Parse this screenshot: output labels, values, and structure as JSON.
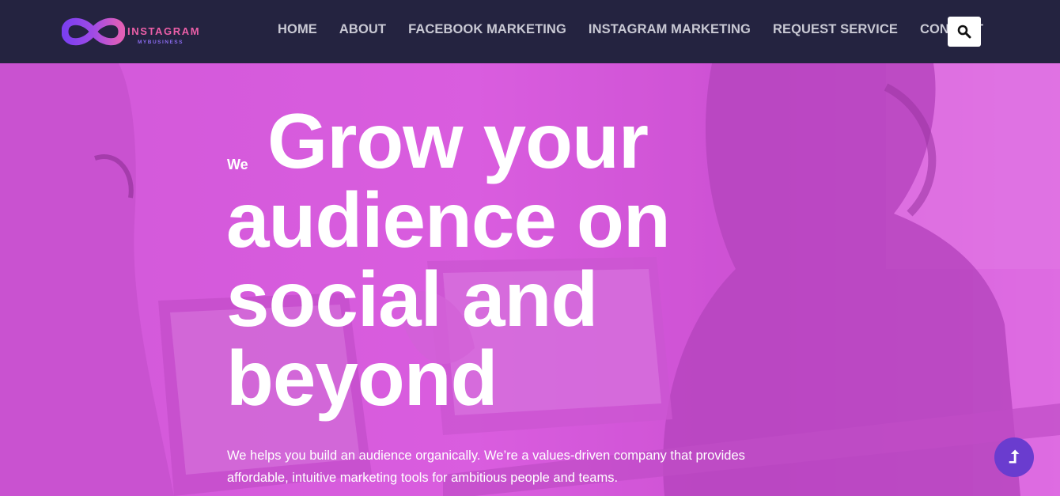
{
  "brand": {
    "name": "INSTAGRAM",
    "tagline": "MYBUSINESS"
  },
  "nav": {
    "items": [
      {
        "label": "HOME"
      },
      {
        "label": "ABOUT"
      },
      {
        "label": "FACEBOOK MARKETING"
      },
      {
        "label": "INSTAGRAM MARKETING"
      },
      {
        "label": "REQUEST SERVICE"
      },
      {
        "label": "CONTACT"
      }
    ],
    "search_icon": "search-icon"
  },
  "hero": {
    "prefix": "We",
    "headline": [
      "Grow your",
      "audience on",
      "social and",
      "beyond"
    ],
    "description_line1": "We helps you build an audience organically. We’re a values-driven company that provides",
    "description_line2": "affordable, intuitive marketing tools for ambitious people and teams.",
    "overlay_color": "#d65cdc"
  },
  "back_to_top": {
    "icon": "arrow-up-icon",
    "glyph": "⮥",
    "color": "#6a3ccf"
  },
  "colors": {
    "header_bg": "#242340",
    "nav_text": "#c9c9d4",
    "brand_pink": "#ec5fa8",
    "brand_purple": "#8b6cf0"
  }
}
